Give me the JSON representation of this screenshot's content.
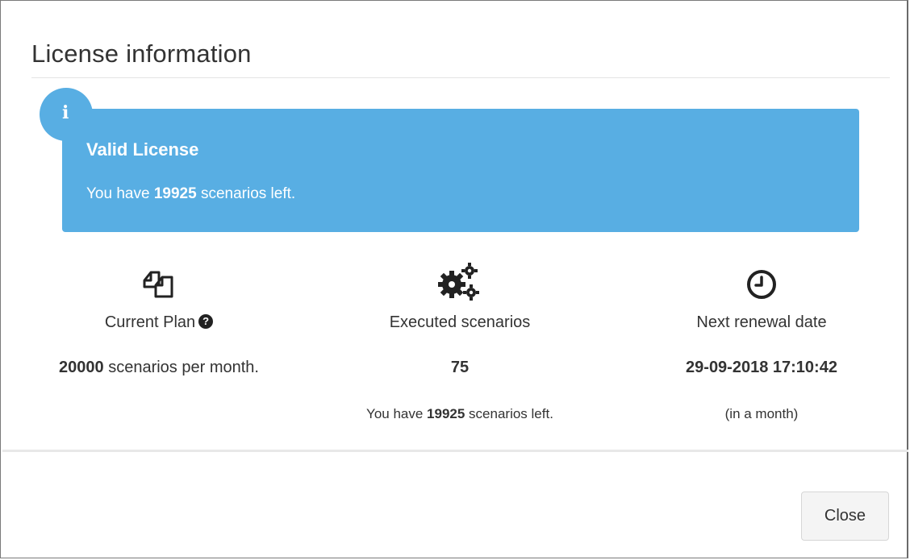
{
  "modal": {
    "title": "License information"
  },
  "callout": {
    "icon": "info-icon",
    "badge_glyph": "i",
    "title": "Valid License",
    "text_prefix": "You have ",
    "text_count": "19925",
    "text_suffix": " scenarios left.",
    "color": "#58aee3"
  },
  "stats": {
    "plan": {
      "icon": "copy-files-icon",
      "label": "Current Plan",
      "help_icon": "question-circle-icon",
      "help_glyph": "?",
      "value_bold": "20000",
      "value_suffix": " scenarios per month."
    },
    "executed": {
      "icon": "gears-icon",
      "label": "Executed scenarios",
      "value": "75",
      "sub_prefix": "You have ",
      "sub_count": "19925",
      "sub_suffix": " scenarios left."
    },
    "renewal": {
      "icon": "clock-icon",
      "label": "Next renewal date",
      "value": "29-09-2018 17:10:42",
      "sub": "(in a month)"
    }
  },
  "footer": {
    "close_label": "Close"
  }
}
